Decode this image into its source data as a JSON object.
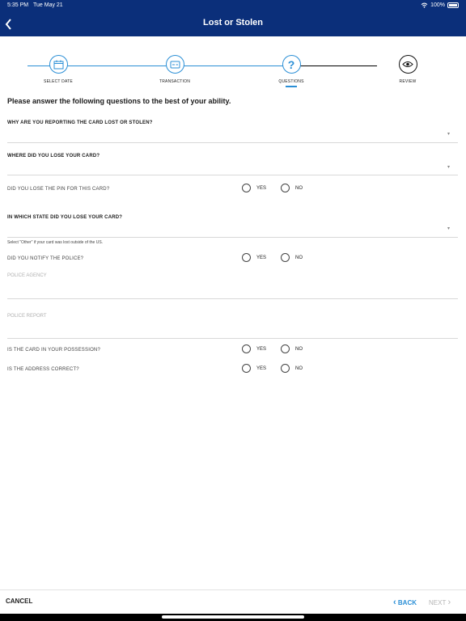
{
  "status_bar": {
    "time": "5:35 PM",
    "date": "Tue May 21",
    "battery": "100%"
  },
  "header": {
    "title": "Lost or Stolen"
  },
  "stepper": {
    "steps": [
      {
        "label": "SELECT DATE",
        "icon": "calendar-icon",
        "state": "done"
      },
      {
        "label": "TRANSACTION",
        "icon": "credit-card-icon",
        "state": "done"
      },
      {
        "label": "QUESTIONS",
        "icon": "question-icon",
        "state": "active"
      },
      {
        "label": "REVIEW",
        "icon": "eye-icon",
        "state": "upcoming"
      }
    ],
    "question_symbol": "?"
  },
  "form": {
    "intro": "Please answer the following questions to the best of your ability.",
    "q_reason": "WHY ARE YOU REPORTING THE CARD LOST OR STOLEN?",
    "q_where": "WHERE DID YOU LOSE YOUR CARD?",
    "q_pin": "DID YOU LOSE THE PIN FOR THIS CARD?",
    "q_state": "IN WHICH STATE DID YOU LOSE YOUR CARD?",
    "state_hint": "Select \"Other\" if your card was lost outside of the US.",
    "q_police": "DID YOU NOTIFY THE POLICE?",
    "police_agency_placeholder": "POLICE AGENCY",
    "police_report_placeholder": "POLICE REPORT",
    "q_possession": "IS THE CARD IN YOUR POSSESSION?",
    "q_address": "IS THE ADDRESS CORRECT?",
    "yes_label": "YES",
    "no_label": "NO",
    "caret": "▾"
  },
  "footer": {
    "cancel": "CANCEL",
    "back": "BACK",
    "next": "NEXT",
    "back_chevron": "‹",
    "next_chevron": "›"
  },
  "colors": {
    "header_bg": "#0b2f7a",
    "accent": "#2b8fd6",
    "disabled": "#b5b5b5"
  }
}
